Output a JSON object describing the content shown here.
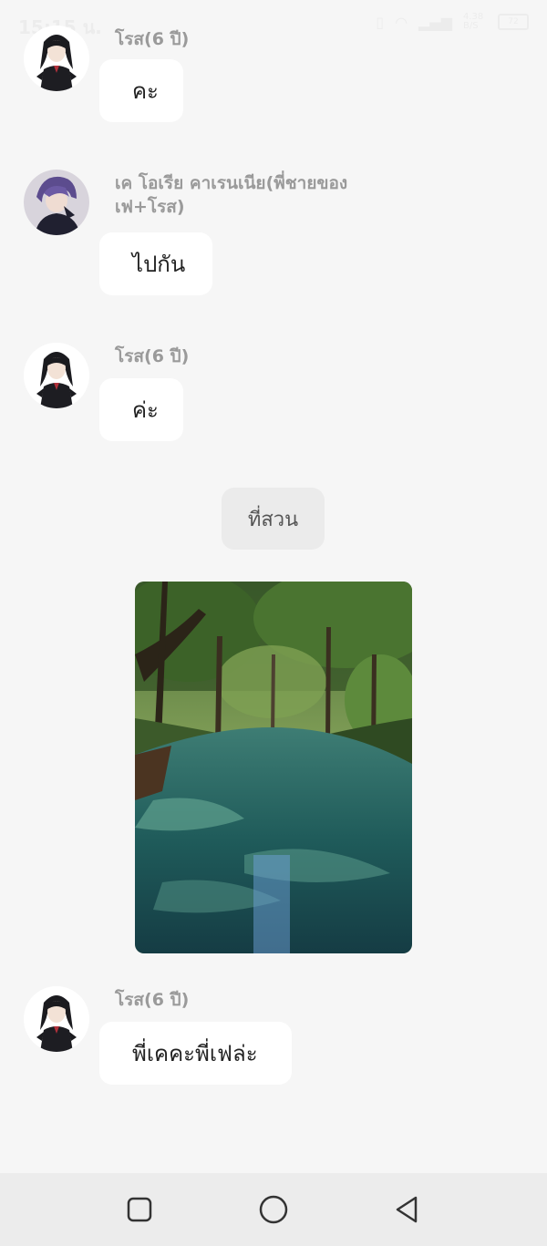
{
  "status_bar": {
    "time": "15:15 น.",
    "network_speed": "4.38 B/S",
    "battery": "72"
  },
  "messages": [
    {
      "sender": "โรส(6 ปี)",
      "text": "คะ",
      "avatar_icon": "girl-avatar-icon"
    },
    {
      "sender": "เค โอเรีย คาเรนเนีย(พี่ชายของ เฟ+โรส)",
      "text": "ไปกัน",
      "avatar_icon": "boy-avatar-icon"
    },
    {
      "sender": "โรส(6 ปี)",
      "text": "ค่ะ",
      "avatar_icon": "girl-avatar-icon"
    },
    {
      "sender": "โรส(6 ปี)",
      "text": "พี่เคคะพี่เฟล่ะ",
      "avatar_icon": "girl-avatar-icon"
    }
  ],
  "scene": {
    "label": "ที่สวน",
    "image_icon": "forest-river-image"
  },
  "nav": {
    "recent_icon": "square-icon",
    "home_icon": "circle-icon",
    "back_icon": "triangle-back-icon"
  },
  "colors": {
    "background": "#f6f6f6",
    "bubble": "#ffffff",
    "sender_text": "#9a9a9a",
    "nav_bar": "#ececec"
  }
}
